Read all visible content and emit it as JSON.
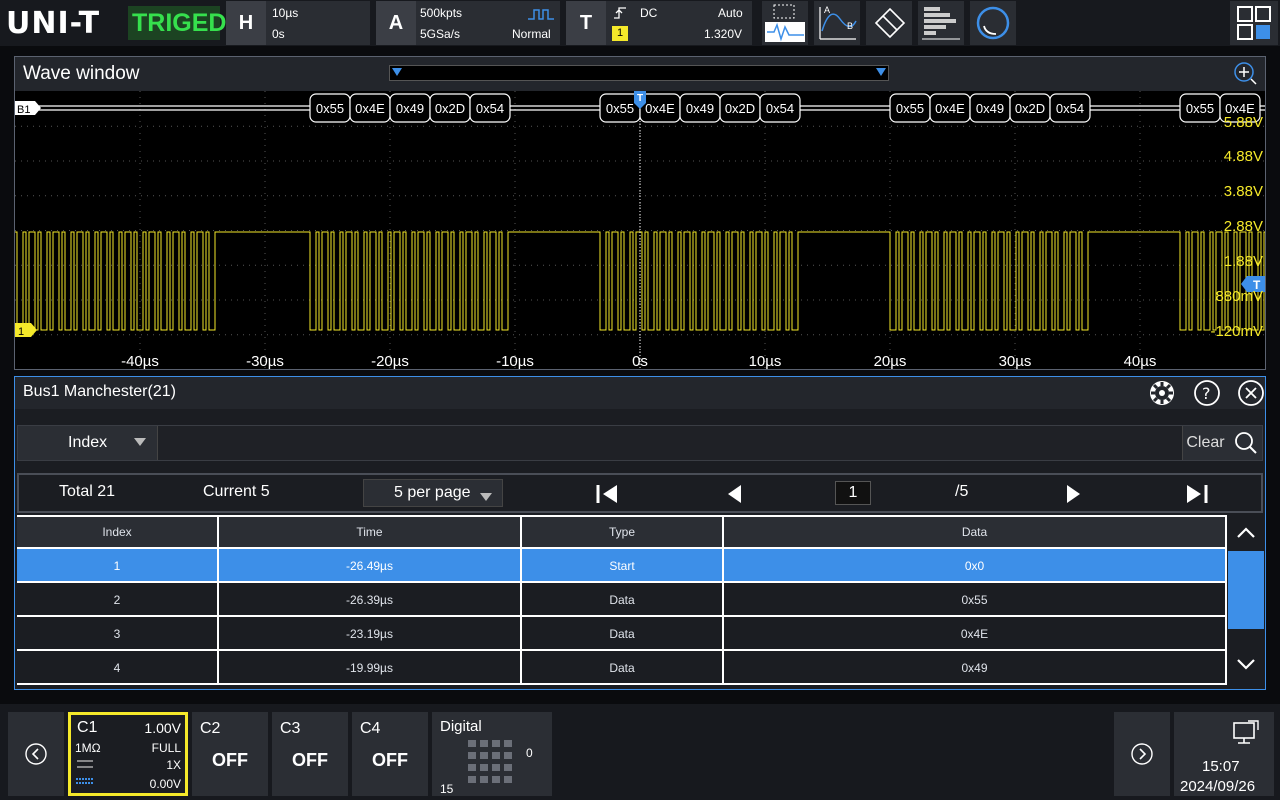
{
  "brand": {
    "logo": "UNI-T",
    "status": "TRIGED"
  },
  "horizontal": {
    "label": "H",
    "timebase": "10µs",
    "offset": "0s"
  },
  "acquire": {
    "label": "A",
    "depth": "500kpts",
    "rate": "5GSa/s",
    "mode": "Normal"
  },
  "trigger": {
    "label": "T",
    "coupling": "DC",
    "mode": "Auto",
    "source": "1",
    "level": "1.320V"
  },
  "wave": {
    "title": "Wave window",
    "bus_label": "B1",
    "ch_marker": "1",
    "trig_marker": "T",
    "packets": [
      [
        "0x55",
        "0x4E",
        "0x49",
        "0x2D",
        "0x54"
      ],
      [
        "0x55",
        "0x4E",
        "0x49",
        "0x2D",
        "0x54"
      ],
      [
        "0x55",
        "0x4E",
        "0x49",
        "0x2D",
        "0x54"
      ],
      [
        "0x55",
        "0x4E"
      ]
    ],
    "volt_labels": [
      "5.88V",
      "4.88V",
      "3.88V",
      "2.88V",
      "1.88V",
      "880mV",
      "-120mV"
    ],
    "time_labels": [
      "-40µs",
      "-30µs",
      "-20µs",
      "-10µs",
      "0s",
      "10µs",
      "20µs",
      "30µs",
      "40µs"
    ]
  },
  "decode": {
    "title": "Bus1 Manchester(21)",
    "search_field": "Index",
    "clear_label": "Clear",
    "total": "Total 21",
    "current": "Current 5",
    "per_page": "5 per page",
    "page": "1",
    "pages": "/5",
    "columns": [
      "Index",
      "Time",
      "Type",
      "Data"
    ],
    "rows": [
      {
        "index": "1",
        "time": "-26.49µs",
        "type": "Start",
        "data": "0x0"
      },
      {
        "index": "2",
        "time": "-26.39µs",
        "type": "Data",
        "data": "0x55"
      },
      {
        "index": "3",
        "time": "-23.19µs",
        "type": "Data",
        "data": "0x4E"
      },
      {
        "index": "4",
        "time": "-19.99µs",
        "type": "Data",
        "data": "0x49"
      }
    ]
  },
  "channels": {
    "c1": {
      "name": "C1",
      "scale": "1.00V",
      "impedance": "1MΩ",
      "bandwidth": "FULL",
      "probe": "1X",
      "offset": "0.00V"
    },
    "c2": {
      "name": "C2",
      "state": "OFF"
    },
    "c3": {
      "name": "C3",
      "state": "OFF"
    },
    "c4": {
      "name": "C4",
      "state": "OFF"
    },
    "digital": {
      "name": "Digital",
      "lo": "0",
      "hi": "15"
    }
  },
  "clock": {
    "time": "15:07",
    "date": "2024/09/26"
  },
  "colors": {
    "accent": "#3d8fe8",
    "channel1": "#f5e92a",
    "triged": "#36e04d"
  }
}
